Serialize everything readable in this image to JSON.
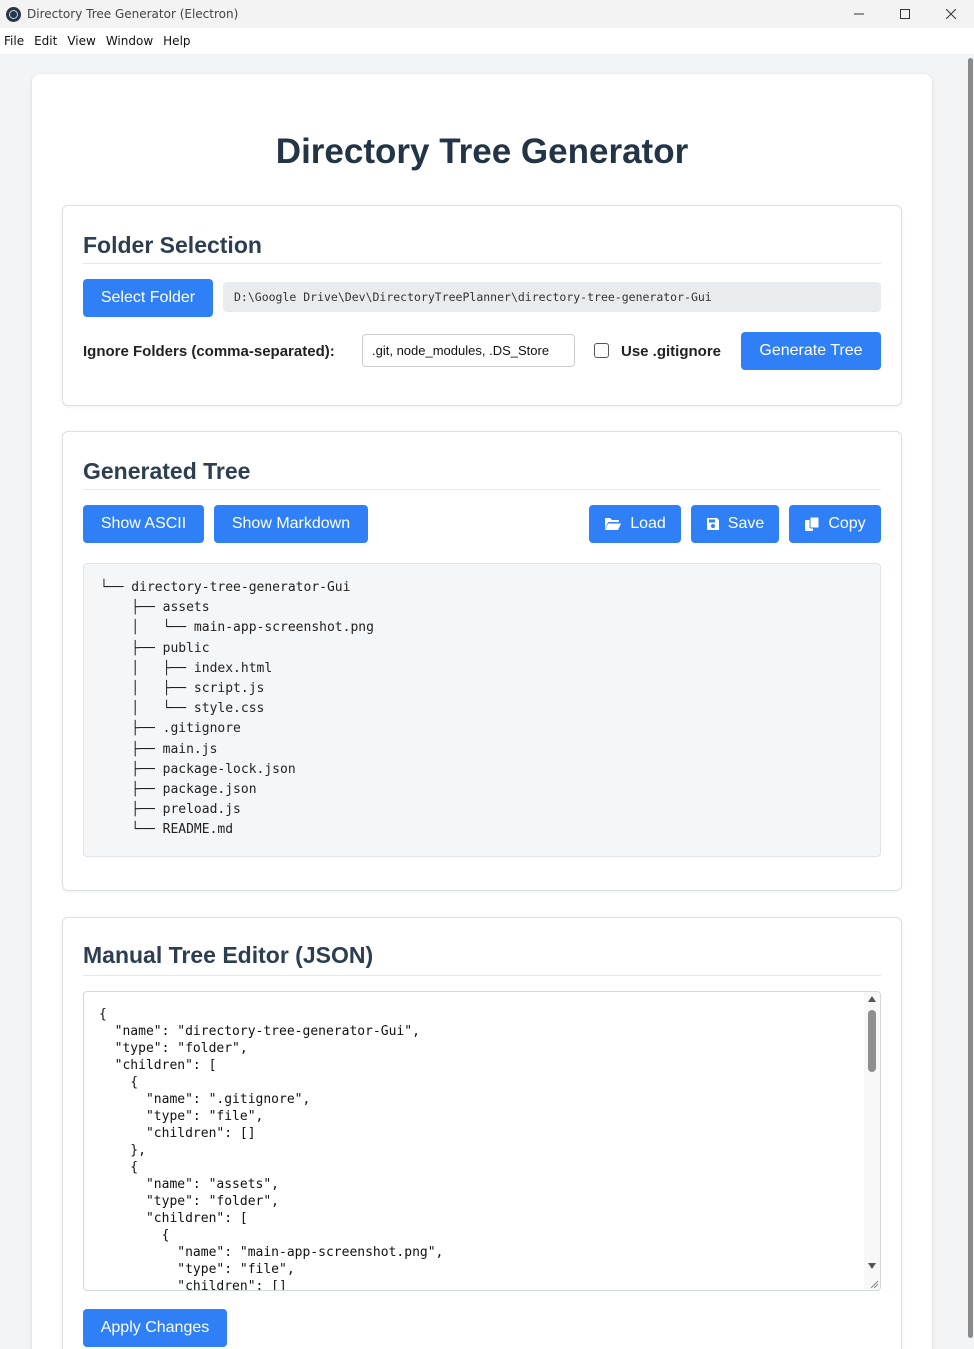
{
  "window": {
    "title": "Directory Tree Generator (Electron)",
    "minimize_icon": "minimize-icon",
    "maximize_icon": "maximize-icon",
    "close_icon": "close-icon"
  },
  "menu": [
    "File",
    "Edit",
    "View",
    "Window",
    "Help"
  ],
  "page": {
    "title": "Directory Tree Generator"
  },
  "folder_selection": {
    "title": "Folder Selection",
    "select_button": "Select Folder",
    "selected_path": "D:\\Google Drive\\Dev\\DirectoryTreePlanner\\directory-tree-generator-Gui",
    "ignore_label": "Ignore Folders (comma-separated):",
    "ignore_value": ".git, node_modules, .DS_Store",
    "use_gitignore_label": "Use .gitignore",
    "use_gitignore_checked": false,
    "generate_button": "Generate Tree"
  },
  "generated_tree": {
    "title": "Generated Tree",
    "show_ascii": "Show ASCII",
    "show_markdown": "Show Markdown",
    "load": "Load",
    "save": "Save",
    "copy": "Copy",
    "output": "└── directory-tree-generator-Gui\n    ├── assets\n    │   └── main-app-screenshot.png\n    ├── public\n    │   ├── index.html\n    │   ├── script.js\n    │   └── style.css\n    ├── .gitignore\n    ├── main.js\n    ├── package-lock.json\n    ├── package.json\n    ├── preload.js\n    └── README.md"
  },
  "json_editor": {
    "title": "Manual Tree Editor (JSON)",
    "content": "{\n  \"name\": \"directory-tree-generator-Gui\",\n  \"type\": \"folder\",\n  \"children\": [\n    {\n      \"name\": \".gitignore\",\n      \"type\": \"file\",\n      \"children\": []\n    },\n    {\n      \"name\": \"assets\",\n      \"type\": \"folder\",\n      \"children\": [\n        {\n          \"name\": \"main-app-screenshot.png\",\n          \"type\": \"file\",\n          \"children\": []",
    "apply_button": "Apply Changes"
  },
  "colors": {
    "accent": "#2f7ff7",
    "heading": "#2c3e50"
  }
}
